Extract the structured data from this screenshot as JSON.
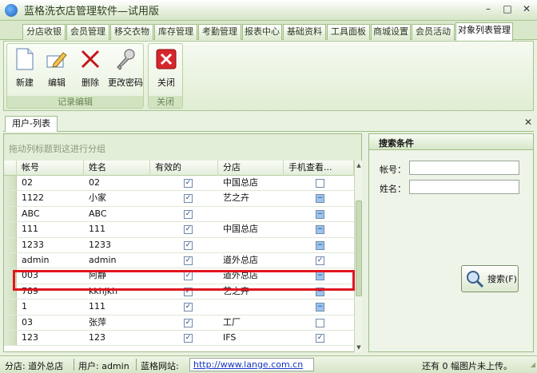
{
  "window": {
    "title": "蓝格洗衣店管理软件—试用版",
    "min": "–",
    "max": "□",
    "close": "✕"
  },
  "tabs": [
    "分店收银",
    "会员管理",
    "移交衣物",
    "库存管理",
    "考勤管理",
    "报表中心",
    "基础资料",
    "工具面板",
    "商城设置",
    "会员活动",
    "对象列表管理"
  ],
  "ribbon": {
    "record_group": "记录编辑",
    "close_group": "关闭",
    "new": "新建",
    "edit": "编辑",
    "delete": "删除",
    "change_pwd": "更改密码",
    "close": "关闭"
  },
  "doc_tab": "用户-列表",
  "doc_close": "✕",
  "grid": {
    "group_hint": "拖动列标题到这进行分组",
    "columns": [
      "帐号",
      "姓名",
      "有效的",
      "分店",
      "手机查看..."
    ],
    "rows": [
      {
        "account": "02",
        "name": "02",
        "valid": true,
        "store": "中国总店",
        "mobile": "empty"
      },
      {
        "account": "1122",
        "name": "小家",
        "valid": true,
        "store": "艺之卉",
        "mobile": "blue"
      },
      {
        "account": "ABC",
        "name": "ABC",
        "valid": true,
        "store": "",
        "mobile": "blue"
      },
      {
        "account": "111",
        "name": "111",
        "valid": true,
        "store": "中国总店",
        "mobile": "blue"
      },
      {
        "account": "1233",
        "name": "1233",
        "valid": true,
        "store": "",
        "mobile": "blue"
      },
      {
        "account": "admin",
        "name": "admin",
        "valid": true,
        "store": "道外总店",
        "mobile": "check"
      },
      {
        "account": "003",
        "name": "阿静",
        "valid": true,
        "store": "道外总店",
        "mobile": "blue"
      },
      {
        "account": "789",
        "name": "kkhjkh",
        "valid": true,
        "store": "艺之卉",
        "mobile": "blue"
      },
      {
        "account": "1",
        "name": "111",
        "valid": true,
        "store": "",
        "mobile": "blue"
      },
      {
        "account": "03",
        "name": "张萍",
        "valid": true,
        "store": "工厂",
        "mobile": "empty"
      },
      {
        "account": "123",
        "name": "123",
        "valid": true,
        "store": "IFS",
        "mobile": "check"
      }
    ]
  },
  "search": {
    "title": "搜索条件",
    "account_label": "帐号：",
    "name_label": "姓名：",
    "account_value": "",
    "name_value": "",
    "button": "搜索(F)"
  },
  "status": {
    "store": "分店: 道外总店",
    "user": "用户: admin",
    "site_label": "蓝格网站:",
    "site_url": "http://www.lange.com.cn",
    "upload": "还有 0 幅图片未上传。"
  },
  "colors": {
    "accent": "#9fbd86",
    "highlight": "#e0161f",
    "link": "#1535c0"
  }
}
